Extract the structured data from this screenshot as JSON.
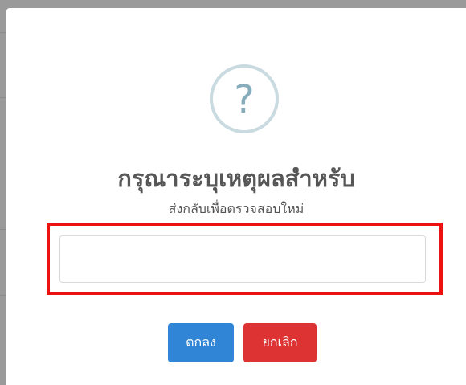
{
  "dialog": {
    "icon": "question-icon",
    "icon_glyph": "?",
    "title": "กรุณาระบุเหตุผลสำหรับ",
    "subtitle": "ส่งกลับเพื่อตรวจสอบใหม่",
    "input": {
      "value": "",
      "placeholder": ""
    },
    "confirm_label": "ตกลง",
    "cancel_label": "ยกเลิก"
  },
  "colors": {
    "confirm": "#3085d6",
    "cancel": "#dd3333",
    "highlight": "#ee1111",
    "icon_ring": "#c9dae1",
    "icon_glyph": "#87adbd",
    "overlay": "#9a9a9a"
  }
}
